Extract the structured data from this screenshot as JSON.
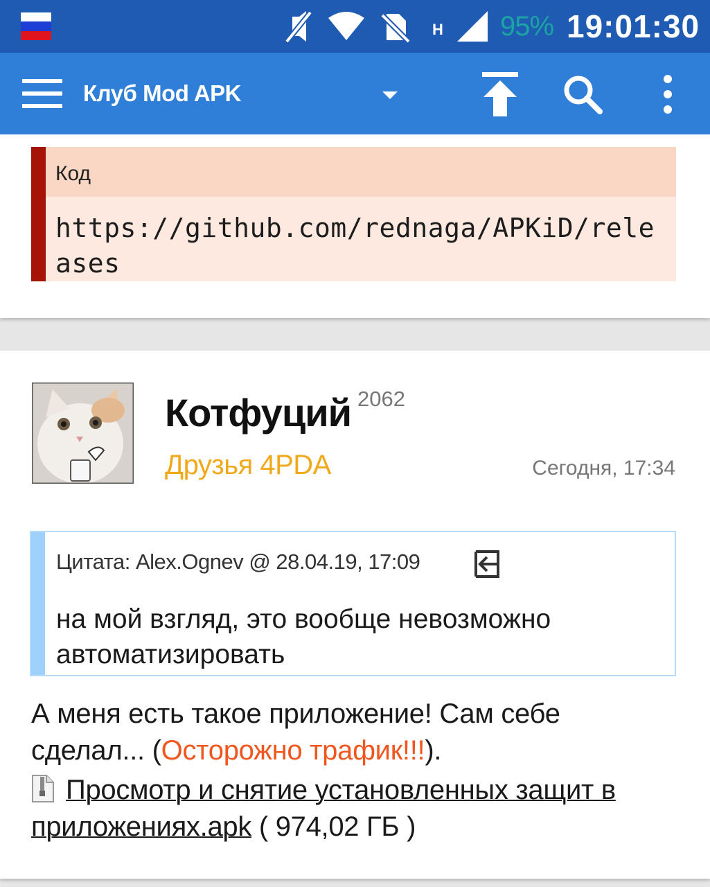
{
  "status_bar": {
    "network_label": "H",
    "battery": "95%",
    "time": "19:01:30",
    "battery_color": "#1aa4a2"
  },
  "app_bar": {
    "title": "Клуб Mod APK",
    "icons": [
      "menu-icon",
      "dropdown-arrow-icon",
      "scroll-top-icon",
      "search-icon",
      "more-vert-icon"
    ]
  },
  "code_block": {
    "label": "Код",
    "text": "https://github.com/rednaga/APKiD/releases"
  },
  "post": {
    "author": "Котфуций",
    "reputation": "2062",
    "group": "Друзья 4PDA",
    "date": "Сегодня, 17:34",
    "quote": {
      "header": "Цитата: Alex.Ognev @ 28.04.19, 17:09",
      "text": "на мой взгляд, это вообще невозможно автоматизировать"
    },
    "body_prefix": "А меня есть такое приложение! Сам себе сделал... (",
    "body_warning": "Осторожно трафик!!!",
    "body_suffix": ").",
    "attachment": {
      "name": "Просмотр и снятие установленных защит в приложениях.apk",
      "size": " ( 974,02 ГБ )"
    }
  },
  "colors": {
    "status_bar": "#1f5bb3",
    "app_bar": "#2f7ed8",
    "code_accent": "#a61408",
    "quote_accent": "#9dd0fb",
    "group_color": "#f0a91a",
    "warning_color": "#f0561d"
  }
}
